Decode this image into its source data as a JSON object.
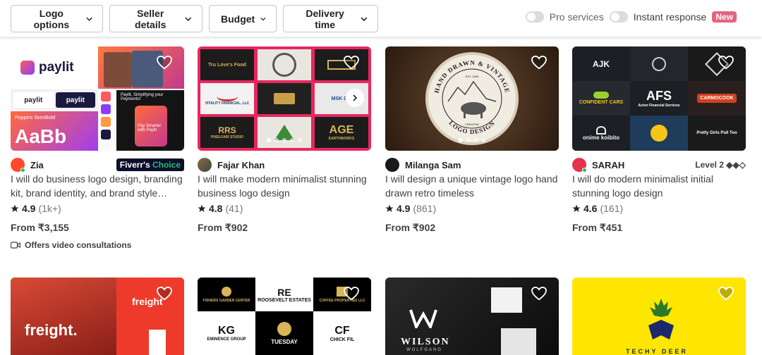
{
  "filters": {
    "logo_options": "Logo options",
    "seller_details": "Seller details",
    "budget": "Budget",
    "delivery_time": "Delivery time"
  },
  "toggles": {
    "pro_services": "Pro services",
    "instant_response": "Instant response",
    "new_badge": "New"
  },
  "colors": {
    "accent_green": "#1dbf73",
    "badge_pink": "#e5637f",
    "choice_navy": "#0e0e2c"
  },
  "gigs": [
    {
      "seller": "Zia",
      "badge": "Fiverr's",
      "badge_accent": "Choice",
      "title": "I will do business logo design, branding kit, brand identity, and brand style…",
      "rating": "4.9",
      "reviews": "(1k+)",
      "price": "From ₹3,155",
      "video": "Offers video consultations",
      "thumb_text": {
        "brand": "paylit",
        "font_name": "Poppins SemiBold",
        "sample": "AaBb",
        "promo_a": "Paylit, Simplifying your Payments!",
        "promo_b": "Pay Smarter with Paylit"
      }
    },
    {
      "seller": "Fajar Khan",
      "title": "I will make modern minimalist stunning business logo design",
      "rating": "4.8",
      "reviews": "(41)",
      "price": "From ₹902",
      "thumb_text": {
        "a": "Tru Love's Food",
        "b": "VITALITY FINANCIAL, LLC",
        "c": "MSK CLI",
        "d": "RRS",
        "e": "PIXELFAIR STUDIO",
        "f": "AGE",
        "g": "EARTHWORKS"
      }
    },
    {
      "seller": "Milanga Sam",
      "title": "I will design a unique vintage logo hand drawn retro timeless",
      "rating": "4.9",
      "reviews": "(861)",
      "price": "From ₹902",
      "thumb_text": {
        "arc_top": "HAND DRAWN & VINTAGE",
        "arc_bottom": "LOGO DESIGN",
        "est": "EST. 1995",
        "creative": "CREATIVE"
      }
    },
    {
      "seller": "SARAH",
      "level": "Level 2 ◆◆◇",
      "title": "I will do modern minimalist initial stunning logo design",
      "rating": "4.6",
      "reviews": "(161)",
      "price": "From ₹451",
      "thumb_text": {
        "a": "AJK",
        "b": "CONFIDENT CARS",
        "c": "AFS",
        "d": "Acton Financial Services",
        "e": "CARMOCOOK",
        "f": "onime koibito",
        "g": "Pretty Girls Pull Too"
      }
    },
    {
      "thumb_text": {
        "brand": "freight",
        "brand_large": "freight."
      }
    },
    {
      "thumb_text": {
        "a": "FISHERS GARDEN CENTER",
        "b": "ROOSEVELT ESTATES",
        "c": "COFFEE PROPERTIES LLC",
        "d": "EMINENCE GROUP",
        "e": "TUESDAY",
        "f": "CHICK FIL"
      }
    },
    {
      "thumb_text": {
        "brand": "WILSON",
        "sub": "WOLFGANG"
      }
    },
    {
      "thumb_text": {
        "brand": "TECHY DEER"
      }
    }
  ]
}
